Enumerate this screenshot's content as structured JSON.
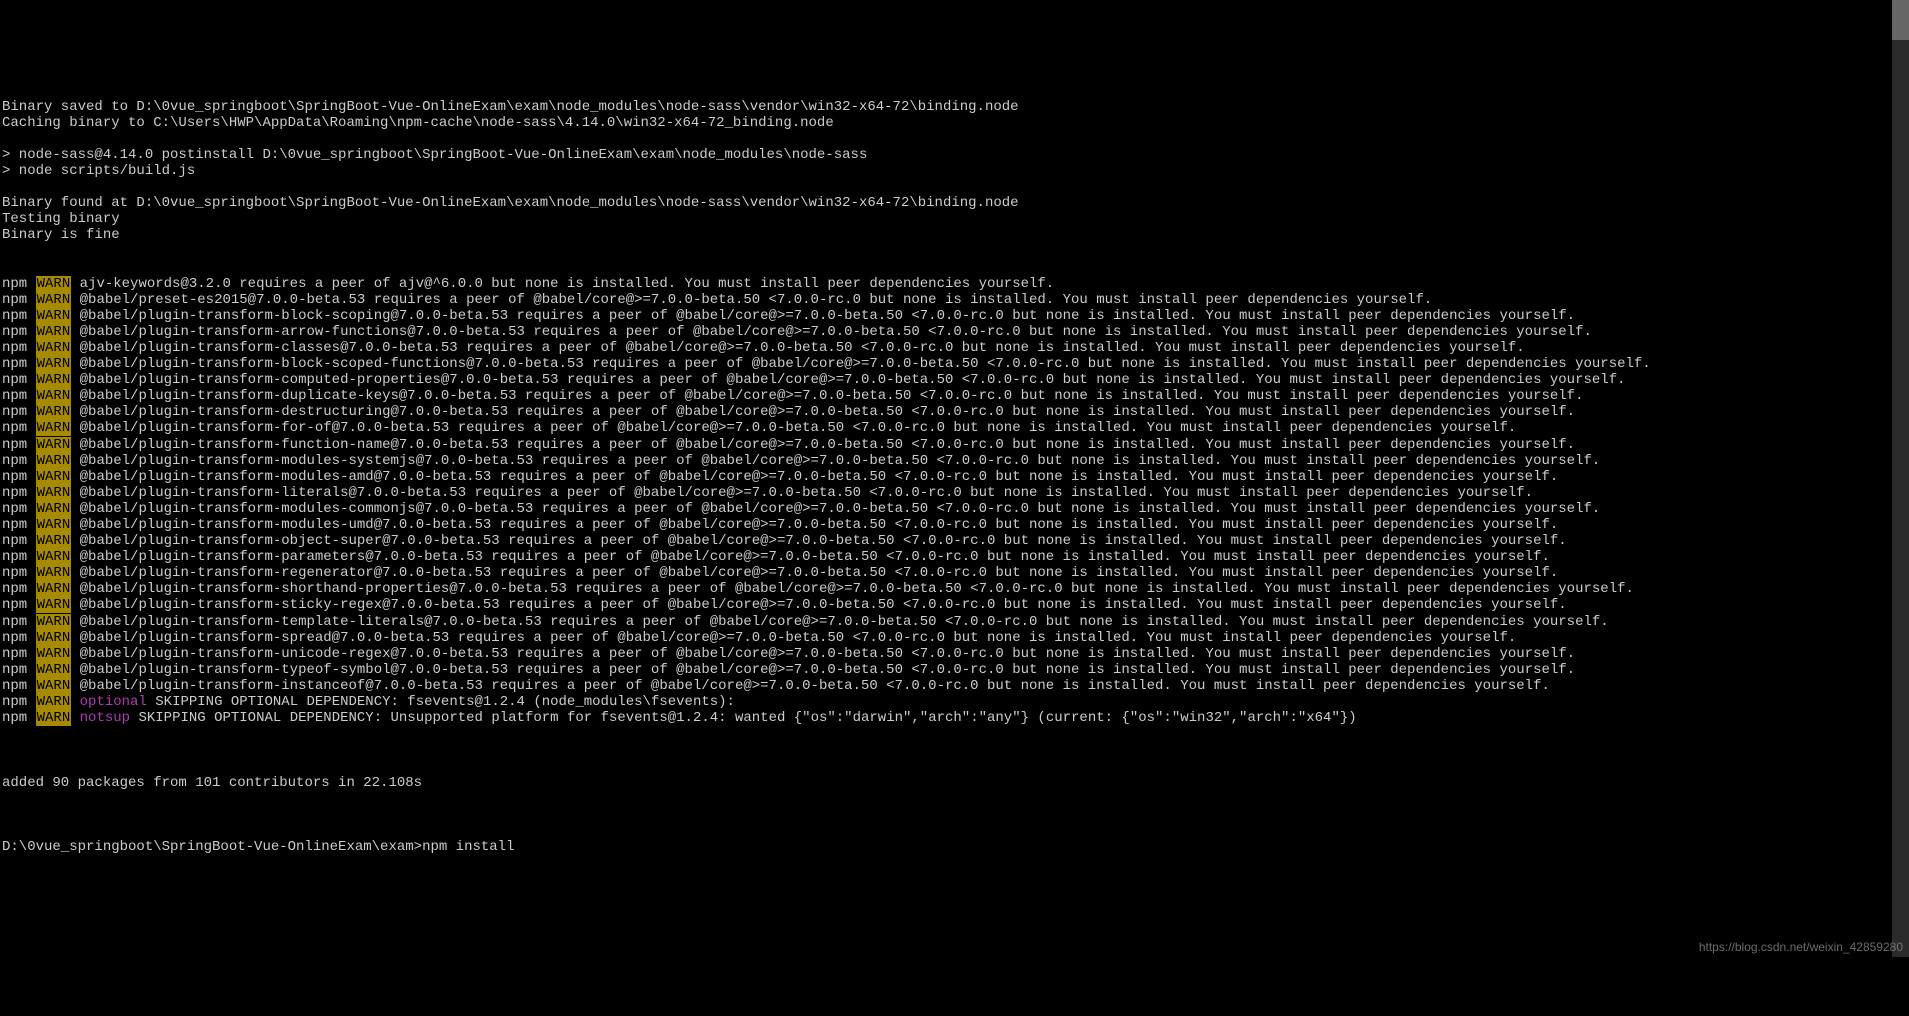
{
  "header_lines": [
    "Binary saved to D:\\0vue_springboot\\SpringBoot-Vue-OnlineExam\\exam\\node_modules\\node-sass\\vendor\\win32-x64-72\\binding.node",
    "Caching binary to C:\\Users\\HWP\\AppData\\Roaming\\npm-cache\\node-sass\\4.14.0\\win32-x64-72_binding.node",
    "",
    "> node-sass@4.14.0 postinstall D:\\0vue_springboot\\SpringBoot-Vue-OnlineExam\\exam\\node_modules\\node-sass",
    "> node scripts/build.js",
    "",
    "Binary found at D:\\0vue_springboot\\SpringBoot-Vue-OnlineExam\\exam\\node_modules\\node-sass\\vendor\\win32-x64-72\\binding.node",
    "Testing binary",
    "Binary is fine"
  ],
  "npm_label": "npm",
  "warn_label": "WARN",
  "warns": [
    {
      "tag": "",
      "msg": "ajv-keywords@3.2.0 requires a peer of ajv@^6.0.0 but none is installed. You must install peer dependencies yourself."
    },
    {
      "tag": "",
      "msg": "@babel/preset-es2015@7.0.0-beta.53 requires a peer of @babel/core@>=7.0.0-beta.50 <7.0.0-rc.0 but none is installed. You must install peer dependencies yourself."
    },
    {
      "tag": "",
      "msg": "@babel/plugin-transform-block-scoping@7.0.0-beta.53 requires a peer of @babel/core@>=7.0.0-beta.50 <7.0.0-rc.0 but none is installed. You must install peer dependencies yourself."
    },
    {
      "tag": "",
      "msg": "@babel/plugin-transform-arrow-functions@7.0.0-beta.53 requires a peer of @babel/core@>=7.0.0-beta.50 <7.0.0-rc.0 but none is installed. You must install peer dependencies yourself."
    },
    {
      "tag": "",
      "msg": "@babel/plugin-transform-classes@7.0.0-beta.53 requires a peer of @babel/core@>=7.0.0-beta.50 <7.0.0-rc.0 but none is installed. You must install peer dependencies yourself."
    },
    {
      "tag": "",
      "msg": "@babel/plugin-transform-block-scoped-functions@7.0.0-beta.53 requires a peer of @babel/core@>=7.0.0-beta.50 <7.0.0-rc.0 but none is installed. You must install peer dependencies yourself."
    },
    {
      "tag": "",
      "msg": "@babel/plugin-transform-computed-properties@7.0.0-beta.53 requires a peer of @babel/core@>=7.0.0-beta.50 <7.0.0-rc.0 but none is installed. You must install peer dependencies yourself."
    },
    {
      "tag": "",
      "msg": "@babel/plugin-transform-duplicate-keys@7.0.0-beta.53 requires a peer of @babel/core@>=7.0.0-beta.50 <7.0.0-rc.0 but none is installed. You must install peer dependencies yourself."
    },
    {
      "tag": "",
      "msg": "@babel/plugin-transform-destructuring@7.0.0-beta.53 requires a peer of @babel/core@>=7.0.0-beta.50 <7.0.0-rc.0 but none is installed. You must install peer dependencies yourself."
    },
    {
      "tag": "",
      "msg": "@babel/plugin-transform-for-of@7.0.0-beta.53 requires a peer of @babel/core@>=7.0.0-beta.50 <7.0.0-rc.0 but none is installed. You must install peer dependencies yourself."
    },
    {
      "tag": "",
      "msg": "@babel/plugin-transform-function-name@7.0.0-beta.53 requires a peer of @babel/core@>=7.0.0-beta.50 <7.0.0-rc.0 but none is installed. You must install peer dependencies yourself."
    },
    {
      "tag": "",
      "msg": "@babel/plugin-transform-modules-systemjs@7.0.0-beta.53 requires a peer of @babel/core@>=7.0.0-beta.50 <7.0.0-rc.0 but none is installed. You must install peer dependencies yourself."
    },
    {
      "tag": "",
      "msg": "@babel/plugin-transform-modules-amd@7.0.0-beta.53 requires a peer of @babel/core@>=7.0.0-beta.50 <7.0.0-rc.0 but none is installed. You must install peer dependencies yourself."
    },
    {
      "tag": "",
      "msg": "@babel/plugin-transform-literals@7.0.0-beta.53 requires a peer of @babel/core@>=7.0.0-beta.50 <7.0.0-rc.0 but none is installed. You must install peer dependencies yourself."
    },
    {
      "tag": "",
      "msg": "@babel/plugin-transform-modules-commonjs@7.0.0-beta.53 requires a peer of @babel/core@>=7.0.0-beta.50 <7.0.0-rc.0 but none is installed. You must install peer dependencies yourself."
    },
    {
      "tag": "",
      "msg": "@babel/plugin-transform-modules-umd@7.0.0-beta.53 requires a peer of @babel/core@>=7.0.0-beta.50 <7.0.0-rc.0 but none is installed. You must install peer dependencies yourself."
    },
    {
      "tag": "",
      "msg": "@babel/plugin-transform-object-super@7.0.0-beta.53 requires a peer of @babel/core@>=7.0.0-beta.50 <7.0.0-rc.0 but none is installed. You must install peer dependencies yourself."
    },
    {
      "tag": "",
      "msg": "@babel/plugin-transform-parameters@7.0.0-beta.53 requires a peer of @babel/core@>=7.0.0-beta.50 <7.0.0-rc.0 but none is installed. You must install peer dependencies yourself."
    },
    {
      "tag": "",
      "msg": "@babel/plugin-transform-regenerator@7.0.0-beta.53 requires a peer of @babel/core@>=7.0.0-beta.50 <7.0.0-rc.0 but none is installed. You must install peer dependencies yourself."
    },
    {
      "tag": "",
      "msg": "@babel/plugin-transform-shorthand-properties@7.0.0-beta.53 requires a peer of @babel/core@>=7.0.0-beta.50 <7.0.0-rc.0 but none is installed. You must install peer dependencies yourself."
    },
    {
      "tag": "",
      "msg": "@babel/plugin-transform-sticky-regex@7.0.0-beta.53 requires a peer of @babel/core@>=7.0.0-beta.50 <7.0.0-rc.0 but none is installed. You must install peer dependencies yourself."
    },
    {
      "tag": "",
      "msg": "@babel/plugin-transform-template-literals@7.0.0-beta.53 requires a peer of @babel/core@>=7.0.0-beta.50 <7.0.0-rc.0 but none is installed. You must install peer dependencies yourself."
    },
    {
      "tag": "",
      "msg": "@babel/plugin-transform-spread@7.0.0-beta.53 requires a peer of @babel/core@>=7.0.0-beta.50 <7.0.0-rc.0 but none is installed. You must install peer dependencies yourself."
    },
    {
      "tag": "",
      "msg": "@babel/plugin-transform-unicode-regex@7.0.0-beta.53 requires a peer of @babel/core@>=7.0.0-beta.50 <7.0.0-rc.0 but none is installed. You must install peer dependencies yourself."
    },
    {
      "tag": "",
      "msg": "@babel/plugin-transform-typeof-symbol@7.0.0-beta.53 requires a peer of @babel/core@>=7.0.0-beta.50 <7.0.0-rc.0 but none is installed. You must install peer dependencies yourself."
    },
    {
      "tag": "",
      "msg": "@babel/plugin-transform-instanceof@7.0.0-beta.53 requires a peer of @babel/core@>=7.0.0-beta.50 <7.0.0-rc.0 but none is installed. You must install peer dependencies yourself."
    },
    {
      "tag": "optional",
      "msg": "SKIPPING OPTIONAL DEPENDENCY: fsevents@1.2.4 (node_modules\\fsevents):"
    },
    {
      "tag": "notsup",
      "msg": "SKIPPING OPTIONAL DEPENDENCY: Unsupported platform for fsevents@1.2.4: wanted {\"os\":\"darwin\",\"arch\":\"any\"} (current: {\"os\":\"win32\",\"arch\":\"x64\"})"
    }
  ],
  "footer_lines": [
    "",
    "added 90 packages from 101 contributors in 22.108s",
    ""
  ],
  "prompt": "D:\\0vue_springboot\\SpringBoot-Vue-OnlineExam\\exam>npm install",
  "watermark": "https://blog.csdn.net/weixin_42859280"
}
